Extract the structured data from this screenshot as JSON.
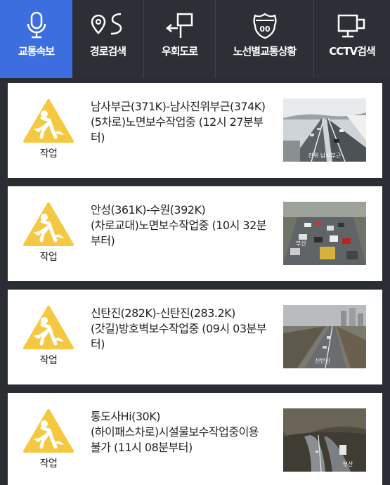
{
  "nav": {
    "items": [
      {
        "label": "교통속보",
        "icon": "microphone-icon",
        "active": true
      },
      {
        "label": "경로검색",
        "icon": "route-icon",
        "active": false
      },
      {
        "label": "우회도로",
        "icon": "detour-icon",
        "active": false
      },
      {
        "label": "노선별교통상황",
        "icon": "highway-shield-icon",
        "active": false
      },
      {
        "label": "CCTV검색",
        "icon": "cctv-monitor-icon",
        "active": false
      }
    ],
    "active_color": "#3d6ee0"
  },
  "incidents": [
    {
      "badge": "작업",
      "text": "남사부근(371K)-남사진위부근(374K)\n(5차로)노면보수작업중 (12시 27분부터)",
      "thumb_caption": "진위 남사부근"
    },
    {
      "badge": "작업",
      "text": "안성(361K)-수원(392K)\n(차로교대)노면보수작업중 (10시 32분부터)",
      "thumb_caption": "부산"
    },
    {
      "badge": "작업",
      "text": "신탄진(282K)-신탄진(283.2K)\n(갓길)방호벽보수작업중 (09시 03분부터)",
      "thumb_caption": "신탄진"
    },
    {
      "badge": "작업",
      "text": "통도사Hi(30K)\n(하이패스차로)시설물보수작업중이용불가 (11시 08분부터)",
      "thumb_caption": "부산"
    }
  ],
  "colors": {
    "warning": "#f5c842",
    "header": "#2c2f36"
  }
}
